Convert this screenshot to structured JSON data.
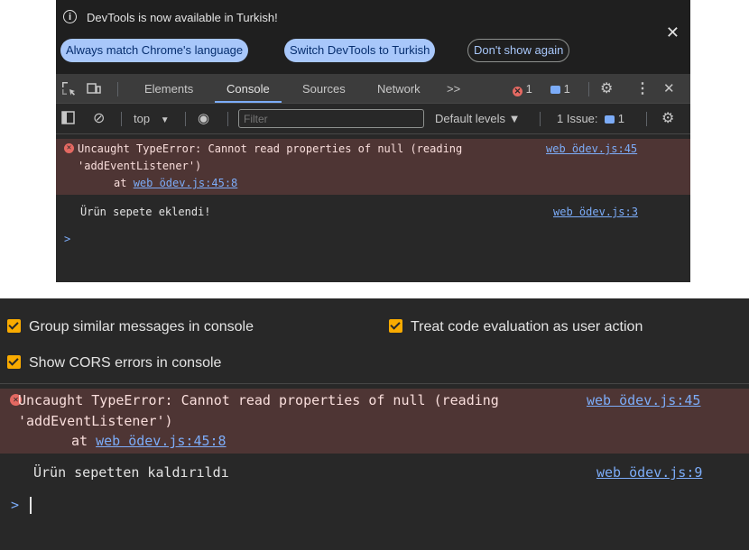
{
  "infobar": {
    "message": "DevTools is now available in Turkish!",
    "buttons": [
      "Always match Chrome's language",
      "Switch DevTools to Turkish",
      "Don't show again"
    ],
    "close_glyph": "✕"
  },
  "toolbar": {
    "tabs": [
      "Elements",
      "Console",
      "Sources",
      "Network"
    ],
    "more_glyph": ">>",
    "error_count": "1",
    "message_count": "1",
    "close_glyph": "✕"
  },
  "console_toolbar": {
    "context": "top",
    "filter_placeholder": "Filter",
    "levels": "Default levels ▼",
    "issues_label": "1 Issue:",
    "issues_count": "1"
  },
  "top_console": {
    "error_line1": "Uncaught TypeError: Cannot read properties of null (reading",
    "error_line2": "'addEventListener')",
    "error_at": "at ",
    "error_stack_link": "web ödev.js:45:8",
    "error_source": "web ödev.js:45",
    "log_text": "Ürün sepete eklendi!",
    "log_source": "web ödev.js:3",
    "prompt": ">"
  },
  "settings": {
    "group_similar": "Group similar messages in console",
    "treat_code": "Treat code evaluation as user action",
    "show_cors": "Show CORS errors in console"
  },
  "bottom_console": {
    "error_line1": "Uncaught TypeError: Cannot read properties of null (reading",
    "error_line2": "'addEventListener')",
    "error_at": "at ",
    "error_stack_link": "web ödev.js:45:8",
    "error_source": "web ödev.js:45",
    "log_text": "Ürün sepetten kaldırıldı",
    "log_source": "web ödev.js:9",
    "prompt": ">"
  },
  "colors": {
    "panel_bg": "#282828",
    "error_bg": "#4e3534",
    "link": "#7cacf8",
    "checkbox": "#f9ab00"
  }
}
